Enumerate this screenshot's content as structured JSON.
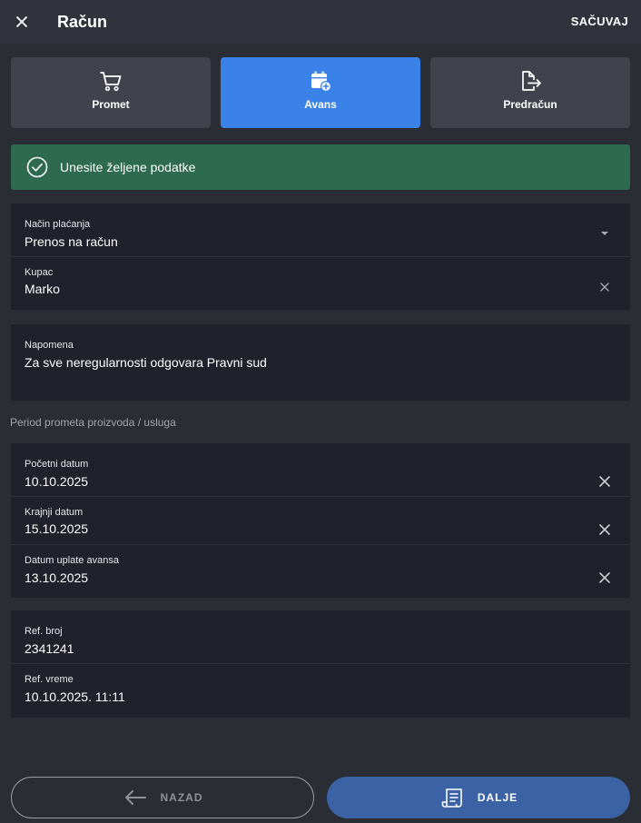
{
  "header": {
    "title": "Račun",
    "close_icon": "close-icon",
    "save_label": "SAČUVAJ"
  },
  "modes": [
    {
      "label": "Promet",
      "icon": "cart-icon",
      "active": false
    },
    {
      "label": "Avans",
      "icon": "calendar-add-icon",
      "active": true
    },
    {
      "label": "Predračun",
      "icon": "file-export-icon",
      "active": false
    }
  ],
  "alert": {
    "icon": "check-circle-icon",
    "text": "Unesite željene podatke"
  },
  "payment": {
    "method_label": "Način plaćanja",
    "method_value": "Prenos na račun",
    "customer_label": "Kupac",
    "customer_value": "Marko"
  },
  "note": {
    "label": "Napomena",
    "value": "Za sve neregularnosti odgovara Pravni sud"
  },
  "period": {
    "section_label": "Period prometa proizvoda / usluga",
    "start_label": "Početni datum",
    "start_value": "10.10.2025",
    "end_label": "Krajnji datum",
    "end_value": "15.10.2025",
    "advance_label": "Datum uplate avansa",
    "advance_value": "13.10.2025"
  },
  "reference": {
    "number_label": "Ref. broj",
    "number_value": "2341241",
    "time_label": "Ref. vreme",
    "time_value": "10.10.2025. 11:11"
  },
  "footer": {
    "back_label": "NAZAD",
    "next_label": "DALJE"
  },
  "colors": {
    "background": "#2b2d35",
    "accent": "#3b82e8",
    "success": "#2e6a4f",
    "next_button": "#3a62a4"
  }
}
